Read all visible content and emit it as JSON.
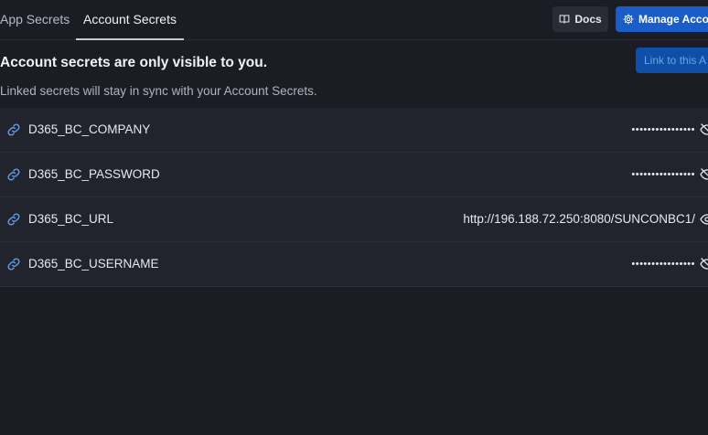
{
  "tabs": {
    "app_secrets": "App Secrets",
    "account_secrets": "Account Secrets"
  },
  "header": {
    "docs_label": "Docs",
    "manage_label": "Manage Accou"
  },
  "intro": {
    "headline": "Account secrets are only visible to you.",
    "subline": "Linked secrets will stay in sync with your Account Secrets.",
    "link_button": "Link to this A"
  },
  "secrets": [
    {
      "key": "D365_BC_COMPANY",
      "value": "••••••••••••••••",
      "masked": true
    },
    {
      "key": "D365_BC_PASSWORD",
      "value": "••••••••••••••••",
      "masked": true
    },
    {
      "key": "D365_BC_URL",
      "value": "http://196.188.72.250:8080/SUNCONBC1/",
      "masked": false
    },
    {
      "key": "D365_BC_USERNAME",
      "value": "••••••••••••••••",
      "masked": true
    }
  ],
  "colors": {
    "background": "#1c1d24",
    "row_background": "#22242d",
    "accent": "#1a5cc8",
    "link_icon": "#5b9ce6"
  }
}
